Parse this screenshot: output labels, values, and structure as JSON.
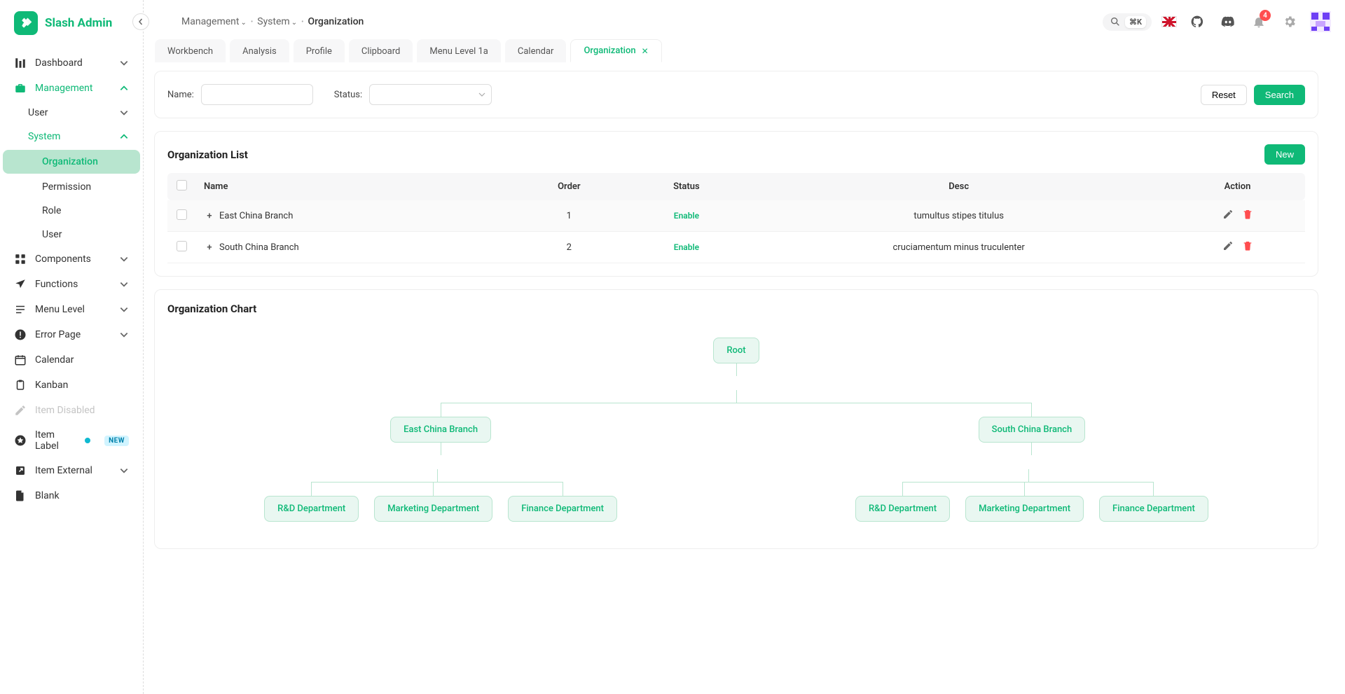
{
  "app": {
    "title": "Slash Admin"
  },
  "sidebar": {
    "items": [
      {
        "key": "dashboard",
        "label": "Dashboard",
        "icon": "chart"
      },
      {
        "key": "management",
        "label": "Management",
        "icon": "briefcase",
        "active": true,
        "open": true,
        "children": [
          {
            "key": "user",
            "label": "User"
          },
          {
            "key": "system",
            "label": "System",
            "active": true,
            "open": true,
            "children": [
              {
                "key": "organization",
                "label": "Organization",
                "active": true
              },
              {
                "key": "permission",
                "label": "Permission"
              },
              {
                "key": "role",
                "label": "Role"
              },
              {
                "key": "user2",
                "label": "User"
              }
            ]
          }
        ]
      },
      {
        "key": "components",
        "label": "Components",
        "icon": "grid"
      },
      {
        "key": "functions",
        "label": "Functions",
        "icon": "plane"
      },
      {
        "key": "menulevel",
        "label": "Menu Level",
        "icon": "list"
      },
      {
        "key": "errorpage",
        "label": "Error Page",
        "icon": "alert"
      },
      {
        "key": "calendar",
        "label": "Calendar",
        "icon": "calendar"
      },
      {
        "key": "kanban",
        "label": "Kanban",
        "icon": "clipboard"
      },
      {
        "key": "itemdisabled",
        "label": "Item Disabled",
        "icon": "pencil",
        "disabled": true
      },
      {
        "key": "itemlabel",
        "label": "Item Label",
        "icon": "star",
        "badge": "NEW"
      },
      {
        "key": "itemexternal",
        "label": "Item External",
        "icon": "external"
      },
      {
        "key": "blank",
        "label": "Blank",
        "icon": "file"
      }
    ]
  },
  "breadcrumb": {
    "parts": [
      "Management",
      "System",
      "Organization"
    ]
  },
  "header": {
    "search_kbd": "⌘K",
    "notification_count": "4"
  },
  "tabs": {
    "items": [
      "Workbench",
      "Analysis",
      "Profile",
      "Clipboard",
      "Menu Level 1a",
      "Calendar",
      "Organization"
    ],
    "active": "Organization"
  },
  "filter": {
    "name_label": "Name:",
    "status_label": "Status:",
    "reset_label": "Reset",
    "search_label": "Search"
  },
  "list": {
    "title": "Organization List",
    "new_label": "New",
    "columns": [
      "Name",
      "Order",
      "Status",
      "Desc",
      "Action"
    ],
    "rows": [
      {
        "name": "East China Branch",
        "order": "1",
        "status": "Enable",
        "desc": "tumultus stipes titulus"
      },
      {
        "name": "South China Branch",
        "order": "2",
        "status": "Enable",
        "desc": "cruciamentum minus truculenter"
      }
    ]
  },
  "chart": {
    "title": "Organization Chart",
    "root": "Root",
    "branches": [
      {
        "name": "East China Branch",
        "depts": [
          "R&D Department",
          "Marketing Department",
          "Finance Department"
        ]
      },
      {
        "name": "South China Branch",
        "depts": [
          "R&D Department",
          "Marketing Department",
          "Finance Department"
        ]
      }
    ]
  }
}
